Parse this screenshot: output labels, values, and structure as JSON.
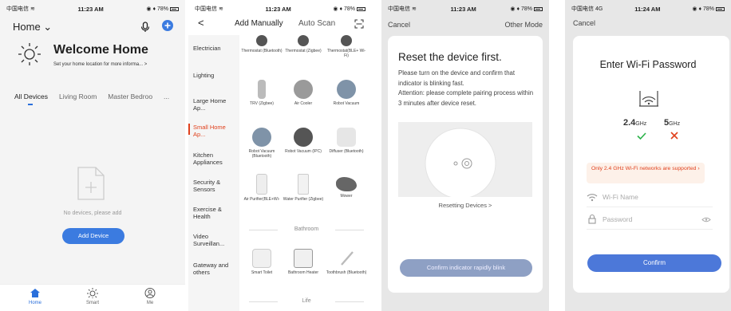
{
  "screen1": {
    "status": {
      "carrier": "中国电信",
      "time": "11:23 AM",
      "battery": "78%"
    },
    "home_title": "Home",
    "welcome_title": "Welcome Home",
    "welcome_sub": "Set your home location for more informa...  >",
    "tabs": [
      "All Devices",
      "Living Room",
      "Master Bedroo",
      "..."
    ],
    "empty_text": "No devices, please add",
    "add_button": "Add Device",
    "tabbar": [
      "Home",
      "Smart",
      "Me"
    ],
    "accent": "#2a6fdb"
  },
  "screen2": {
    "status": {
      "carrier": "中国电信",
      "time": "11:23 AM",
      "battery": "78%"
    },
    "nav_back": "<",
    "nav_title": "Add Manually",
    "nav_scan": "Auto Scan",
    "categories": [
      "Electrician",
      "Lighting",
      "Large Home Ap...",
      "Small Home Ap...",
      "Kitchen Appliances",
      "Security & Sensors",
      "Exercise & Health",
      "Video Surveillan...",
      "Gateway and others"
    ],
    "devices": [
      {
        "name": "Thermostat (Bluetooth)"
      },
      {
        "name": "Thermostat (Zigbee)"
      },
      {
        "name": "Thermostat(BLE+ Wi-Fi)"
      },
      {
        "name": "TRV (Zigbee)"
      },
      {
        "name": "Air Cooler"
      },
      {
        "name": "Robot Vacuum"
      },
      {
        "name": "Robot Vacuum (Bluetooth)"
      },
      {
        "name": "Robot Vacuum (IPC)"
      },
      {
        "name": "Diffuser (Bluetooth)"
      },
      {
        "name": "Air Purifier(BLE+Wi-"
      },
      {
        "name": "Water Purifier (Zigbee)"
      },
      {
        "name": "Mower"
      },
      {
        "name": "Smart Toilet"
      },
      {
        "name": "Bathroom Heater"
      },
      {
        "name": "Toothbrush (Bluetooth)"
      }
    ],
    "section_bathroom": "Bathroom",
    "section_life": "Life",
    "active_color": "#e0401c"
  },
  "screen3": {
    "status": {
      "carrier": "中国电信",
      "time": "11:23 AM",
      "battery": "78%"
    },
    "cancel": "Cancel",
    "other_mode": "Other Mode",
    "heading": "Reset the device first.",
    "body": "Please turn on the device and confirm that indicator is blinking fast.\nAttention: please complete pairing process within 3 minutes after device reset.",
    "reset_link": "Resetting Devices >",
    "confirm_button": "Confirm indicator rapidly blink"
  },
  "screen4": {
    "status": {
      "carrier": "中国电信",
      "network": "4G",
      "time": "11:24 AM",
      "battery": "78%"
    },
    "cancel": "Cancel",
    "heading": "Enter Wi-Fi Password",
    "band_24": "2.4",
    "band_5": "5",
    "band_unit": "GHz",
    "warning": "Only 2.4 GHz Wi-Fi networks are supported",
    "wifi_placeholder": "Wi-Fi Name",
    "password_placeholder": "Password",
    "confirm_button": "Confirm",
    "ok_color": "#2bb34a",
    "bad_color": "#e0401c"
  }
}
